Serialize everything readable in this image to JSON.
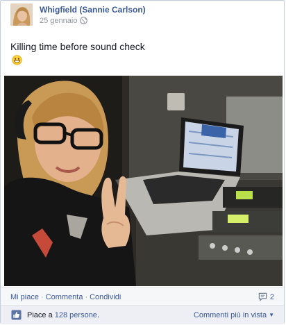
{
  "post": {
    "author": "Whigfield (Sannie Carlson)",
    "date": "25 gennaio",
    "privacy_icon": "globe-icon",
    "status_text": "Killing time before sound check",
    "emoji_icon": "grinning-face-icon"
  },
  "actions": {
    "like": "Mi piace",
    "comment": "Commenta",
    "share": "Condividi",
    "separator": "·",
    "comment_count": "2"
  },
  "likes": {
    "prefix": "Piace a",
    "count_link": "128 persone",
    "suffix": "."
  },
  "comments_sort": {
    "label": "Commenti più in vista"
  },
  "colors": {
    "link": "#3b5998",
    "muted": "#90949c",
    "actions_bg": "#f6f7f9",
    "likes_bg": "#edeff4"
  }
}
